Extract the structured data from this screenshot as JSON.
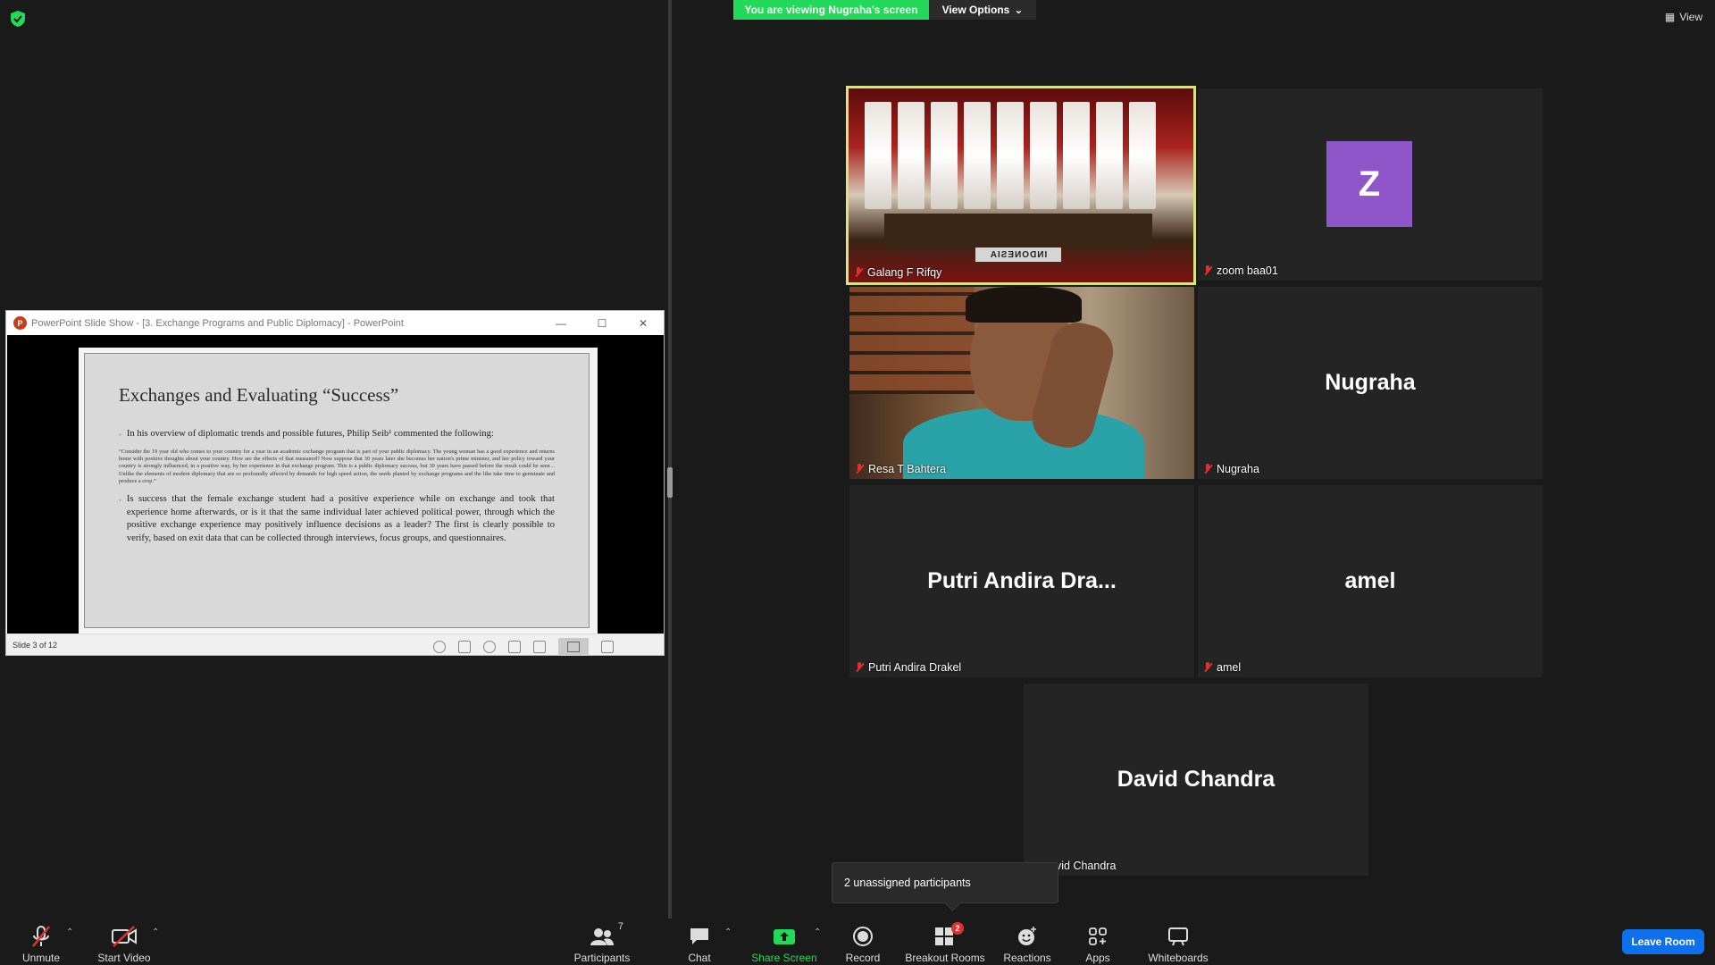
{
  "banner": {
    "viewing_text": "You are viewing Nugraha's screen",
    "view_options_label": "View Options",
    "view_label": "View"
  },
  "ppt": {
    "window_title": "PowerPoint Slide Show - [3. Exchange Programs and Public Diplomacy] - PowerPoint",
    "slide_counter": "Slide 3 of 12",
    "slide": {
      "title": "Exchanges and Evaluating “Success”",
      "bullet1": "In his overview of diplomatic trends and possible futures, Philip Seib¹ commented the following:",
      "quote": "“Consider the 19 year old who comes to your country for a year in an academic exchange program that is part of your public diplomacy. The young woman has a good experience and returns home with positive thoughts about your country. How are the effects of that measured? Now suppose that 30 years later she becomes her nation's prime minister, and her policy toward your country is strongly influenced, in a positive way, by her experience in that exchange program. This is a public diplomacy success, but 30 years have passed before the result could be seen .. Unlike the elements of modern diplomacy that are so profoundly affected by demands for high speed action, the seeds planted by exchange programs and the like take time to germinate and produce a crop.”",
      "bullet2": "Is success that the female exchange student had a positive experience while on exchange and took that experience home afterwards, or is it that the same individual later achieved political power, through which the positive exchange experience may positively influence decisions as a leader? The first is clearly possible to verify, based on exit data that can be collected through interviews, focus groups, and questionnaires."
    }
  },
  "participants": [
    {
      "name": "Galang F Rifqy",
      "display": "",
      "muted": true,
      "active_speaker": true
    },
    {
      "name": "zoom baa01",
      "display": "Z",
      "muted": true
    },
    {
      "name": "Resa T Bahtera",
      "display": "",
      "muted": true
    },
    {
      "name": "Nugraha",
      "display": "Nugraha",
      "muted": true
    },
    {
      "name": "Putri Andira Drakel",
      "display": "Putri Andira Dra...",
      "muted": true
    },
    {
      "name": "amel",
      "display": "amel",
      "muted": true
    },
    {
      "name": "vid Chandra",
      "display": "David Chandra",
      "muted": false
    }
  ],
  "scene": {
    "nameplate": "INDONESIA"
  },
  "tooltip": "2 unassigned participants",
  "toolbar": {
    "unmute": "Unmute",
    "start_video": "Start Video",
    "participants": "Participants",
    "participants_count": "7",
    "chat": "Chat",
    "share_screen": "Share Screen",
    "record": "Record",
    "breakout_rooms": "Breakout Rooms",
    "breakout_badge": "2",
    "reactions": "Reactions",
    "apps": "Apps",
    "whiteboards": "Whiteboards",
    "leave_room": "Leave Room"
  },
  "colors": {
    "banner_green": "#23d959",
    "active_border": "#dde27f",
    "leave_blue": "#0e71eb",
    "mute_red": "#e0312f",
    "avatar_purple": "#8e56c9"
  }
}
